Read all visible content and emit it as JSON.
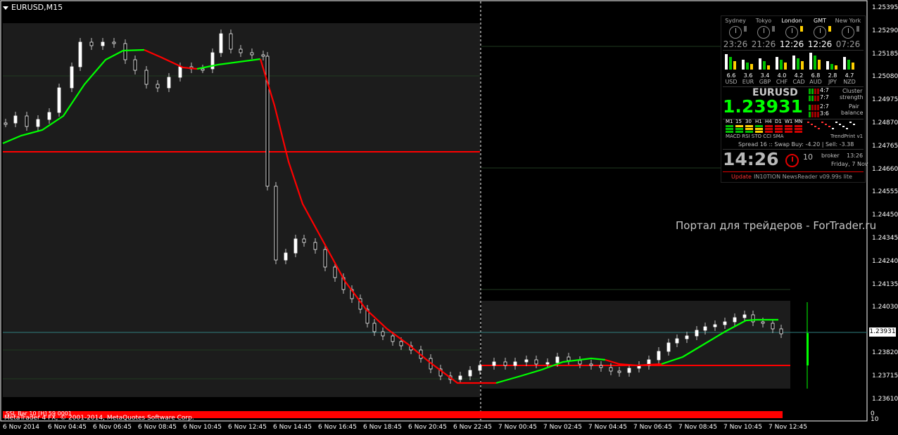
{
  "window": {
    "title": "EURUSD,M15"
  },
  "watermark": "Портал для трейдеров - ForTrader.ru",
  "price_axis": [
    "1.25395",
    "1.25290",
    "1.25185",
    "1.25080",
    "1.24975",
    "1.24870",
    "1.24765",
    "1.24660",
    "1.24555",
    "1.24450",
    "1.24345",
    "1.24240",
    "1.24135",
    "1.24030",
    "1.23931",
    "1.23820",
    "1.23715",
    "1.23610"
  ],
  "current_price": "1.23931",
  "time_axis": [
    "6 Nov 2014",
    "6 Nov 04:45",
    "6 Nov 06:45",
    "6 Nov 08:45",
    "6 Nov 10:45",
    "6 Nov 12:45",
    "6 Nov 14:45",
    "6 Nov 16:45",
    "6 Nov 18:45",
    "6 Nov 20:45",
    "6 Nov 22:45",
    "7 Nov 00:45",
    "7 Nov 02:45",
    "7 Nov 04:45",
    "7 Nov 06:45",
    "7 Nov 08:45",
    "7 Nov 10:45",
    "7 Nov 12:45"
  ],
  "footer": {
    "indicator_text": "SSL Bar 10 [H] 59 0001",
    "copyright": "MetaTrader 4 FX, © 2001-2014, MetaQuotes Software Corp.",
    "side_top": "0",
    "side_bottom": "10"
  },
  "panel": {
    "cities": [
      {
        "name": "Sydney",
        "time": "23:26",
        "active": false
      },
      {
        "name": "Tokyo",
        "time": "21:26",
        "active": false
      },
      {
        "name": "London",
        "time": "12:26",
        "active": true
      },
      {
        "name": "GMT",
        "time": "12:26",
        "active": true
      },
      {
        "name": "New York",
        "time": "07:26",
        "active": false
      }
    ],
    "currencies": [
      {
        "name": "USD",
        "value": "6.6"
      },
      {
        "name": "EUR",
        "value": "3.6"
      },
      {
        "name": "GBP",
        "value": "3.4"
      },
      {
        "name": "CHF",
        "value": "4.0"
      },
      {
        "name": "CAD",
        "value": "4.2"
      },
      {
        "name": "AUD",
        "value": "6.8"
      },
      {
        "name": "JPY",
        "value": "2.8"
      },
      {
        "name": "NZD",
        "value": "4.7"
      }
    ],
    "pair": "EURUSD",
    "bid": "1.23931",
    "cluster_top": "4:7",
    "cluster_bottom": "7:7",
    "cluster_label1": "Cluster",
    "cluster_label2": "strength",
    "balance_top": "2:7",
    "balance_bottom": "3:6",
    "balance_label1": "Pair",
    "balance_label2": "balance",
    "timeframes": [
      "M1",
      "15",
      "30",
      "H1",
      "H4",
      "D1",
      "W1",
      "MN"
    ],
    "indicators": "MACD  RSI STO CCI  SMA",
    "trendprint": "TrendPrint v1",
    "spread_line": "Spread   16  ::  Swap Buy: -4.20  |  Sell: -3.38",
    "time": "14:26",
    "minutes": "10",
    "broker_label": "broker",
    "broker_time": "13:26",
    "date": "Friday, 7 Nov",
    "update": "Update",
    "newsreader": "IN10TION NewsReader v09.99s lite"
  },
  "colors": {
    "bull_line": "#00ff00",
    "bear_line": "#ff0000",
    "level_line": "#ff0000",
    "bid_line": "#2f8080"
  }
}
